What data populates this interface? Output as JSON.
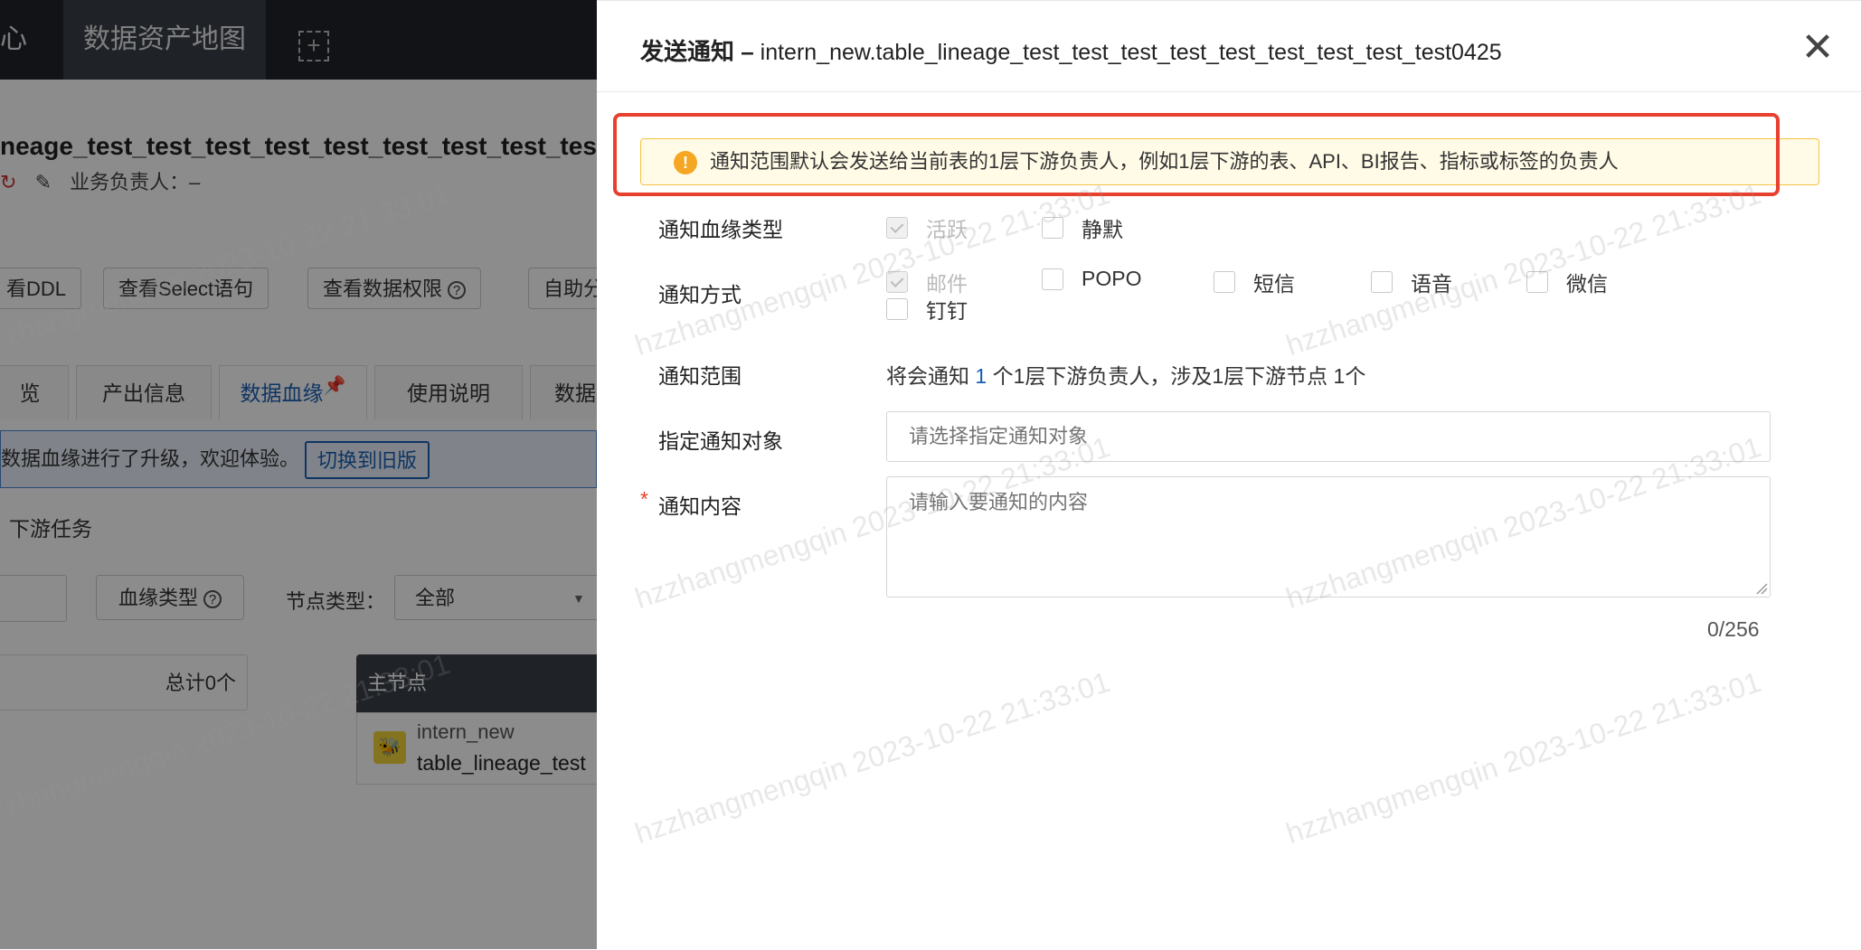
{
  "background": {
    "nav": {
      "left_fragment": "心",
      "active_tab": "数据资产地图",
      "add_icon": "plus-box-icon"
    },
    "table_title": "neage_test_test_test_test_test_test_test_test_test",
    "owner_label": "业务负责人：–",
    "buttons": [
      "看DDL",
      "查看Select语句",
      "查看数据权限",
      "自助分"
    ],
    "tabs": [
      "览",
      "产出信息",
      "数据血缘",
      "使用说明",
      "数据"
    ],
    "upgrade_notice": "数据血缘进行了升级，欢迎体验。",
    "switch_old_label": "切换到旧版",
    "downstream_label": "下游任务",
    "lineage_type_label": "血缘类型",
    "node_type_label": "节点类型：",
    "node_type_value": "全部",
    "total_label": "总计0个",
    "main_node_label": "主节点",
    "node_db": "intern_new",
    "node_table": "table_lineage_test"
  },
  "drawer": {
    "title_prefix": "发送通知 –",
    "title_table": "intern_new.table_lineage_test_test_test_test_test_test_test_test_test0425",
    "alert_text": "通知范围默认会发送给当前表的1层下游负责人，例如1层下游的表、API、BI报告、指标或标签的负责人",
    "lineage_type_label": "通知血缘类型",
    "lineage_types": [
      {
        "label": "活跃",
        "checked": true,
        "disabled": true
      },
      {
        "label": "静默",
        "checked": false,
        "disabled": false
      }
    ],
    "method_label": "通知方式",
    "methods": [
      {
        "label": "邮件",
        "checked": true,
        "disabled": true
      },
      {
        "label": "POPO",
        "checked": false,
        "disabled": false
      },
      {
        "label": "短信",
        "checked": false,
        "disabled": false
      },
      {
        "label": "语音",
        "checked": false,
        "disabled": false
      },
      {
        "label": "微信",
        "checked": false,
        "disabled": false
      },
      {
        "label": "钉钉",
        "checked": false,
        "disabled": false
      }
    ],
    "scope_label": "通知范围",
    "scope_text_before": "将会通知 ",
    "scope_count": "1",
    "scope_text_after": " 个1层下游负责人，涉及1层下游节点 1个",
    "target_label": "指定通知对象",
    "target_placeholder": "请选择指定通知对象",
    "required_mark": "*",
    "content_label": "通知内容",
    "content_placeholder": "请输入要通知的内容",
    "char_count": "0/256"
  },
  "watermark": "hzzhangmengqin 2023-10-22 21:33:01",
  "colors": {
    "primary": "#1a5fb4",
    "highlight_frame": "#e8402f",
    "warning": "#f5a623"
  }
}
